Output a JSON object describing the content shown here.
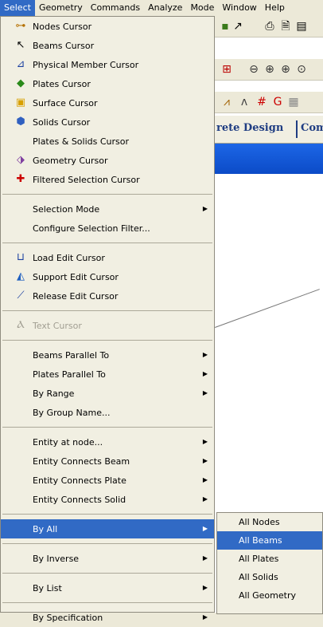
{
  "menubar": [
    "Select",
    "Geometry",
    "Commands",
    "Analyze",
    "Mode",
    "Window",
    "Help"
  ],
  "background": {
    "tab_text": "rete Design",
    "tab_text2": "Com"
  },
  "menu": {
    "nodes": "Nodes Cursor",
    "beams": "Beams Cursor",
    "physical": "Physical Member Cursor",
    "plates": "Plates Cursor",
    "surface": "Surface Cursor",
    "solids": "Solids Cursor",
    "plates_solids": "Plates & Solids Cursor",
    "geometry": "Geometry Cursor",
    "filtered": "Filtered Selection Cursor",
    "selection_mode": "Selection Mode",
    "configure_filter": "Configure Selection Filter...",
    "load_edit": "Load Edit Cursor",
    "support_edit": "Support Edit Cursor",
    "release_edit": "Release Edit Cursor",
    "text_cursor": "Text Cursor",
    "beams_parallel": "Beams Parallel To",
    "plates_parallel": "Plates Parallel To",
    "by_range": "By Range",
    "by_group": "By Group Name...",
    "entity_at_node": "Entity at node...",
    "entity_beam": "Entity Connects Beam",
    "entity_plate": "Entity Connects Plate",
    "entity_solid": "Entity Connects Solid",
    "by_all": "By All",
    "by_inverse": "By Inverse",
    "by_list": "By List",
    "by_spec": "By Specification"
  },
  "submenu": [
    "All Nodes",
    "All Beams",
    "All Plates",
    "All Solids",
    "All Geometry"
  ]
}
